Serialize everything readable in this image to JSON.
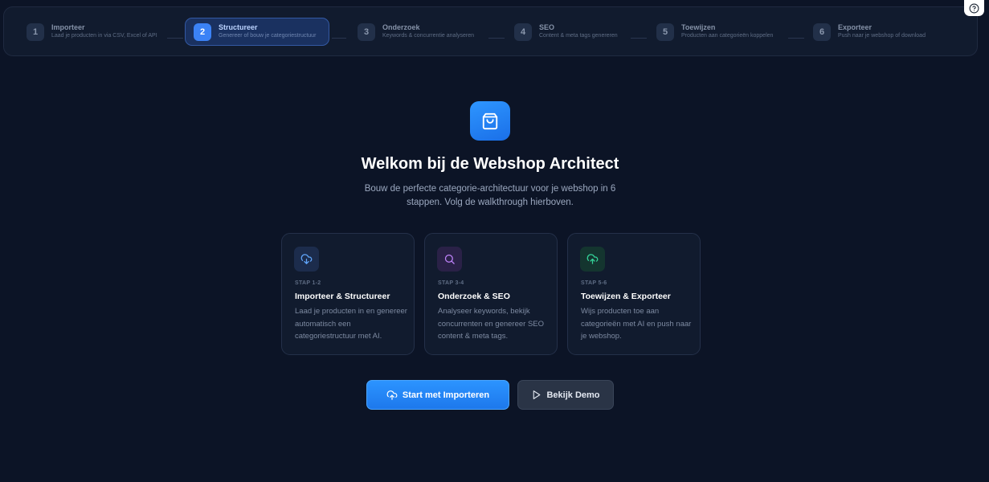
{
  "stepper": {
    "steps": [
      {
        "number": "1",
        "title": "Importeer",
        "description": "Laad je producten in via CSV, Excel of API"
      },
      {
        "number": "2",
        "title": "Structureer",
        "description": "Genereer of bouw je categoriestructuur",
        "active": true
      },
      {
        "number": "3",
        "title": "Onderzoek",
        "description": "Keywords & concurrentie analyseren"
      },
      {
        "number": "4",
        "title": "SEO",
        "description": "Content & meta tags genereren"
      },
      {
        "number": "5",
        "title": "Toewijzen",
        "description": "Producten aan categorieën koppelen"
      },
      {
        "number": "6",
        "title": "Exporteer",
        "description": "Push naar je webshop of download"
      }
    ]
  },
  "help": {
    "icon": "help-circle-icon"
  },
  "hero": {
    "icon": "shopping-bag-icon",
    "title": "Welkom bij de Webshop Architect",
    "subtitle": "Bouw de perfecte categorie-architectuur voor je webshop in 6 stappen. Volg de walkthrough hierboven."
  },
  "cards": [
    {
      "icon": "cloud-download-icon",
      "label": "STAP 1-2",
      "title": "Importeer & Structureer",
      "description": "Laad je producten in en genereer automatisch een categoriestructuur met AI.",
      "accent": "#60a5fa"
    },
    {
      "icon": "search-icon",
      "label": "STAP 3-4",
      "title": "Onderzoek & SEO",
      "description": "Analyseer keywords, bekijk concurrenten en genereer SEO content & meta tags.",
      "accent": "#c084fc"
    },
    {
      "icon": "cloud-upload-icon",
      "label": "STAP 5-6",
      "title": "Toewijzen & Exporteer",
      "description": "Wijs producten toe aan categorieën met AI en push naar je webshop.",
      "accent": "#34d399"
    }
  ],
  "actions": {
    "primary_label": "Start met Importeren",
    "primary_icon": "cloud-upload-icon",
    "secondary_label": "Bekijk Demo",
    "secondary_icon": "play-icon"
  },
  "colors": {
    "background": "#0c1426",
    "accent": "#1d78ec",
    "active_step": "#3b82f6"
  }
}
